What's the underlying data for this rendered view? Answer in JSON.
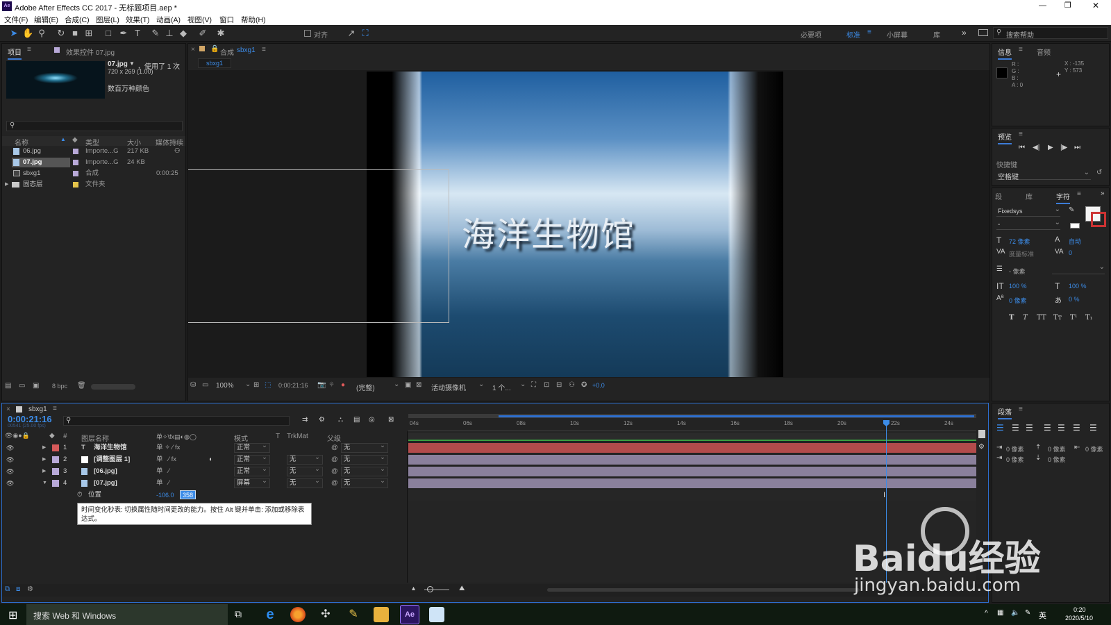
{
  "window": {
    "title": "Adobe After Effects CC 2017 - 无标题项目.aep *",
    "app_badge": "Ae",
    "controls": [
      "—",
      "❐",
      "✕"
    ]
  },
  "menu": [
    "文件(F)",
    "编辑(E)",
    "合成(C)",
    "图层(L)",
    "效果(T)",
    "动画(A)",
    "视图(V)",
    "窗口",
    "帮助(H)"
  ],
  "toolbar": {
    "align_label": "对齐",
    "workspaces": [
      "必要项",
      "标准",
      "小屏幕",
      "库"
    ],
    "active_workspace": "标准",
    "search_placeholder": "搜索帮助"
  },
  "project_panel": {
    "tabs": [
      "项目",
      "效果控件 07.jpg"
    ],
    "preview": {
      "filename": "07.jpg",
      "usage": "，使用了 1 次",
      "dimensions": "720 x 269 (1.00)",
      "colors": "数百万种颜色"
    },
    "search_placeholder": "",
    "columns": [
      "名称",
      "类型",
      "大小",
      "媒体持续"
    ],
    "items": [
      {
        "name": "06.jpg",
        "type": "Importe...G",
        "size": "217 KB",
        "duration": "",
        "color": "#b8a9d8",
        "kind": "file"
      },
      {
        "name": "07.jpg",
        "type": "Importe...G",
        "size": "24 KB",
        "duration": "",
        "color": "#b8a9d8",
        "kind": "file",
        "selected": true
      },
      {
        "name": "sbxg1",
        "type": "合成",
        "size": "",
        "duration": "0:00:25",
        "color": "#b8a9d8",
        "kind": "comp"
      },
      {
        "name": "固态层",
        "type": "文件夹",
        "size": "",
        "duration": "",
        "color": "#e5c44a",
        "kind": "folder"
      }
    ],
    "bpc": "8 bpc"
  },
  "comp_panel": {
    "tab_label": "合成",
    "tab_name": "sbxg1",
    "breadcrumb": "sbxg1",
    "overlay_text": "海洋生物馆",
    "footer": {
      "zoom": "100%",
      "timecode": "0:00:21:16",
      "resolution": "(完整)",
      "camera": "活动摄像机",
      "views": "1 个...",
      "exposure": "+0.0"
    }
  },
  "info_panel": {
    "tabs": [
      "信息",
      "音频"
    ],
    "rgba": [
      "R :",
      "G :",
      "B :",
      "A : 0"
    ],
    "coords": [
      "X : -135",
      "Y : 573"
    ]
  },
  "preview_panel": {
    "title": "预览",
    "shortcut_label": "快捷键",
    "shortcut_value": "空格键"
  },
  "character_panel": {
    "tabs": [
      "段",
      "库",
      "字符"
    ],
    "font": "Fixedsys",
    "style": "-",
    "size": "72 像素",
    "leading": "自动",
    "kerning": "度量标准",
    "tracking": "0",
    "stroke": "- 像素",
    "vscale": "100 %",
    "hscale": "100 %",
    "baseline": "0 像素",
    "tsume": "0 %",
    "styles": [
      "T",
      "T",
      "TT",
      "Tт",
      "T¹",
      "T₁"
    ]
  },
  "paragraph_panel": {
    "title": "段落",
    "indents": [
      "0 像素",
      "0 像素",
      "0 像素",
      "0 像素",
      "0 像素"
    ]
  },
  "timeline": {
    "tab": "sbxg1",
    "timecode": "0:00:21:16",
    "frame_info": "00541 (25.00 fps)",
    "columns": [
      "图层名称",
      "模式",
      "T",
      "TrkMat",
      "父级"
    ],
    "ruler": [
      "04s",
      "06s",
      "08s",
      "10s",
      "12s",
      "14s",
      "16s",
      "18s",
      "20s",
      "22s",
      "24s"
    ],
    "layers": [
      {
        "num": "1",
        "name": "海洋生物馆",
        "mode": "正常",
        "trkmat": "",
        "parent": "无",
        "color": "#d65a5a",
        "kind": "T",
        "bar": "#b24b4b"
      },
      {
        "num": "2",
        "name": "[调整图层 1]",
        "mode": "正常",
        "trkmat": "无",
        "parent": "无",
        "color": "#b8a9d8",
        "kind": "adj",
        "bar": "#8a809c"
      },
      {
        "num": "3",
        "name": "[06.jpg]",
        "mode": "正常",
        "trkmat": "无",
        "parent": "无",
        "color": "#b8a9d8",
        "kind": "img",
        "bar": "#8a809c"
      },
      {
        "num": "4",
        "name": "[07.jpg]",
        "mode": "屏幕",
        "trkmat": "无",
        "parent": "无",
        "color": "#b8a9d8",
        "kind": "img",
        "bar": "#8a809c"
      }
    ],
    "property": {
      "name": "位置",
      "x": "-106.0",
      "y": "358"
    },
    "tooltip": "时间变化秒表: 切换属性随时间更改的能力。按住 Alt 键并单击: 添加或移除表达式。"
  },
  "taskbar": {
    "search": "搜索 Web 和 Windows",
    "time": "0:20",
    "date": "2020/5/10",
    "ime": "英"
  },
  "watermark": {
    "brand": "Baidu经验",
    "url": "jingyan.baidu.com"
  }
}
